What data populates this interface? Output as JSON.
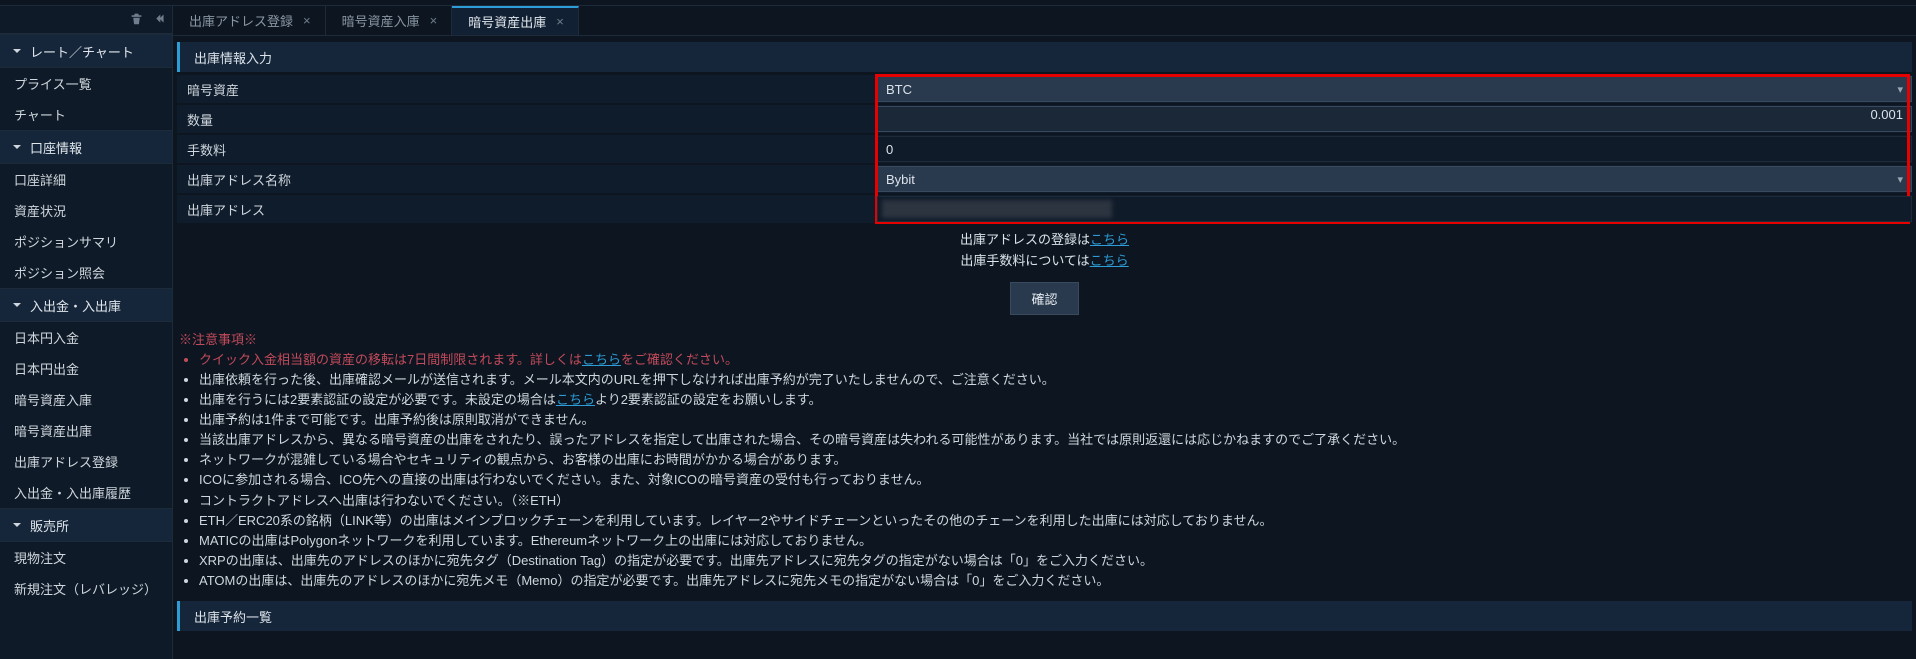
{
  "sidebar": {
    "sections": [
      {
        "title": "レート／チャート",
        "items": [
          "プライス一覧",
          "チャート"
        ]
      },
      {
        "title": "口座情報",
        "items": [
          "口座詳細",
          "資産状況",
          "ポジションサマリ",
          "ポジション照会"
        ]
      },
      {
        "title": "入出金・入出庫",
        "items": [
          "日本円入金",
          "日本円出金",
          "暗号資産入庫",
          "暗号資産出庫",
          "出庫アドレス登録",
          "入出金・入出庫履歴"
        ]
      },
      {
        "title": "販売所",
        "items": [
          "現物注文",
          "新規注文（レバレッジ）"
        ]
      }
    ]
  },
  "tabs": [
    {
      "label": "出庫アドレス登録",
      "active": false
    },
    {
      "label": "暗号資産入庫",
      "active": false
    },
    {
      "label": "暗号資産出庫",
      "active": true
    }
  ],
  "form": {
    "section_title": "出庫情報入力",
    "rows": {
      "crypto_label": "暗号資産",
      "crypto_value": "BTC",
      "qty_label": "数量",
      "qty_value": "0.001",
      "fee_label": "手数料",
      "fee_value": "0",
      "addr_name_label": "出庫アドレス名称",
      "addr_name_value": "Bybit",
      "addr_label": "出庫アドレス"
    }
  },
  "links": {
    "register_prefix": "出庫アドレスの登録は",
    "register_link": "こちら",
    "fee_prefix": "出庫手数料については",
    "fee_link": "こちら"
  },
  "confirm_label": "確認",
  "notice_header": "※注意事項※",
  "notices": [
    {
      "text_pre": "クイック入金相当額の資産の移転は7日間制限されます。詳しくは",
      "link": "こちら",
      "text_post": "をご確認ください。",
      "red": true
    },
    {
      "text": "出庫依頼を行った後、出庫確認メールが送信されます。メール本文内のURLを押下しなければ出庫予約が完了いたしませんので、ご注意ください。"
    },
    {
      "text_pre": "出庫を行うには2要素認証の設定が必要です。未設定の場合は",
      "link": "こちら",
      "text_post": "より2要素認証の設定をお願いします。"
    },
    {
      "text": "出庫予約は1件まで可能です。出庫予約後は原則取消ができません。"
    },
    {
      "text": "当該出庫アドレスから、異なる暗号資産の出庫をされたり、誤ったアドレスを指定して出庫された場合、その暗号資産は失われる可能性があります。当社では原則返還には応じかねますのでご了承ください。"
    },
    {
      "text": "ネットワークが混雑している場合やセキュリティの観点から、お客様の出庫にお時間がかかる場合があります。"
    },
    {
      "text": "ICOに参加される場合、ICO先への直接の出庫は行わないでください。また、対象ICOの暗号資産の受付も行っておりません。"
    },
    {
      "text": "コントラクトアドレスへ出庫は行わないでください。（※ETH）"
    },
    {
      "text": "ETH／ERC20系の銘柄（LINK等）の出庫はメインブロックチェーンを利用しています。レイヤー2やサイドチェーンといったその他のチェーンを利用した出庫には対応しておりません。"
    },
    {
      "text": "MATICの出庫はPolygonネットワークを利用しています。Ethereumネットワーク上の出庫には対応しておりません。"
    },
    {
      "text": "XRPの出庫は、出庫先のアドレスのほかに宛先タグ（Destination Tag）の指定が必要です。出庫先アドレスに宛先タグの指定がない場合は「0」をご入力ください。"
    },
    {
      "text": "ATOMの出庫は、出庫先のアドレスのほかに宛先メモ（Memo）の指定が必要です。出庫先アドレスに宛先メモの指定がない場合は「0」をご入力ください。"
    }
  ],
  "reservation_section_title": "出庫予約一覧"
}
